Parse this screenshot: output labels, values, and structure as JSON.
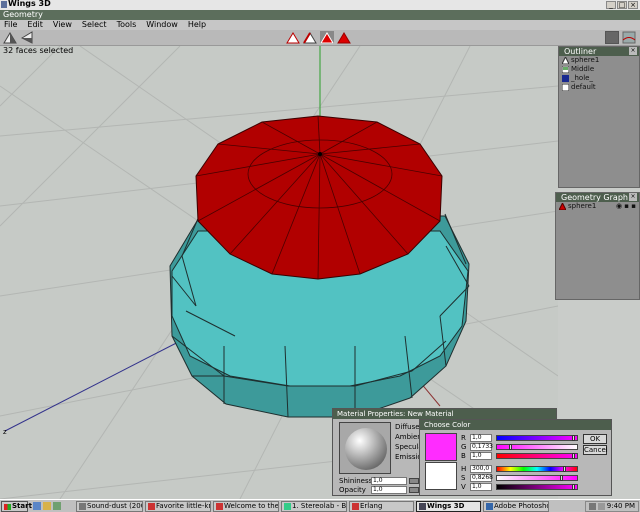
{
  "app": {
    "title": "Wings 3D"
  },
  "geometry_window": {
    "title": "Geometry"
  },
  "menu": [
    "File",
    "Edit",
    "View",
    "Select",
    "Tools",
    "Window",
    "Help"
  ],
  "status": "32 faces selected",
  "outliner": {
    "title": "Outliner",
    "items": [
      {
        "label": "sphere1",
        "icon": "object-icon"
      },
      {
        "label": "Middle",
        "icon": "image-icon"
      },
      {
        "label": "_hole_",
        "icon": "material-icon"
      },
      {
        "label": "default",
        "icon": "material-icon"
      }
    ]
  },
  "geometry_graph": {
    "title": "Geometry Graph",
    "items": [
      {
        "label": "sphere1"
      }
    ]
  },
  "material_dialog": {
    "title": "Material Properties: New Material",
    "labels": [
      "Diffuse",
      "Ambient",
      "Specular",
      "Emission"
    ],
    "shininess_label": "Shininess",
    "shininess_value": "1,0",
    "opacity_label": "Opacity",
    "opacity_value": "1,0"
  },
  "color_dialog": {
    "title": "Choose Color",
    "r_label": "R",
    "r_value": "1,0",
    "g_label": "G",
    "g_value": "0,1733",
    "b_label": "B",
    "b_value": "1,0",
    "h_label": "H",
    "h_value": "300,0",
    "s_label": "S",
    "s_value": "0,8268",
    "v_label": "V",
    "v_value": "1,0",
    "ok_label": "OK",
    "cancel_label": "Cancel",
    "colors": {
      "new": "#ff2cff",
      "old": "#ffffff"
    }
  },
  "taskbar": {
    "start_label": "Start",
    "tasks": [
      "Sound-dust (2001)",
      "Favorite little-know...",
      "Welcome to the Art ...",
      "1. Stereolab - Black ...",
      "Erlang",
      "Wings 3D",
      "Adobe Photoshop"
    ],
    "clock": "9:40 PM"
  },
  "colors": {
    "selected_face": "#b10000",
    "mesh": "#42a8a8",
    "panel_header": "#4d5e4d"
  }
}
